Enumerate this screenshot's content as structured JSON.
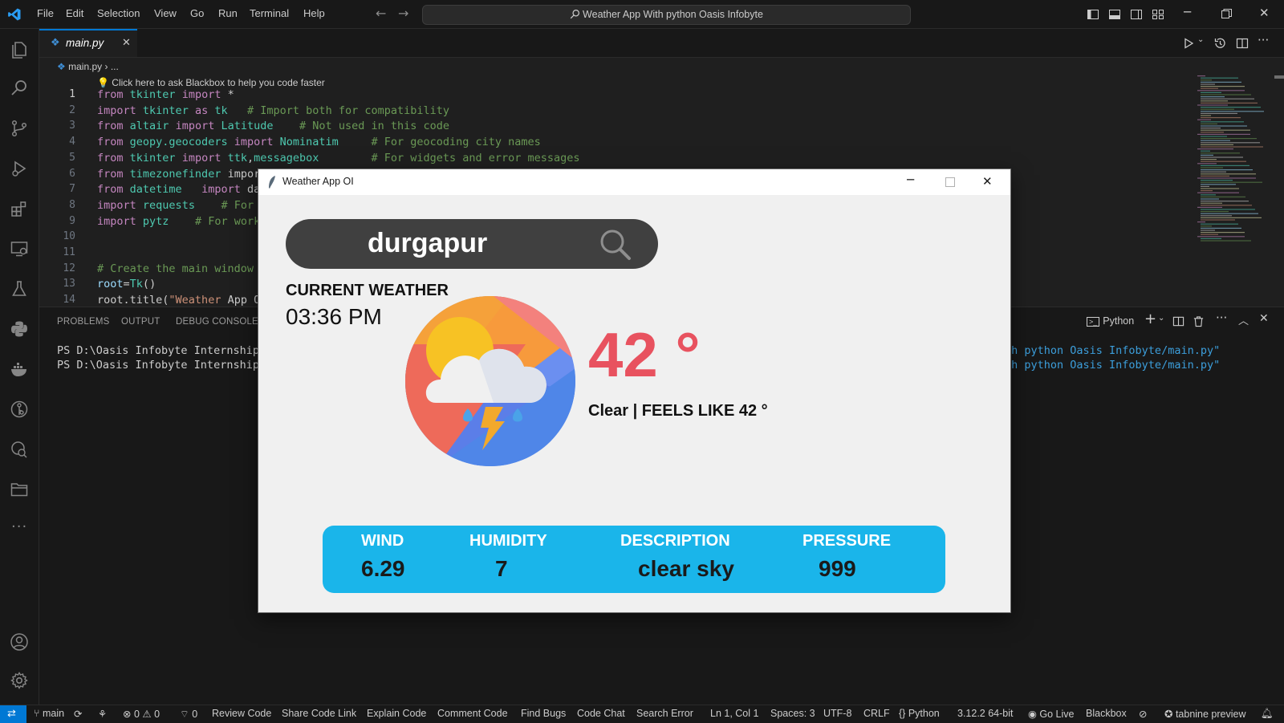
{
  "titlebar": {
    "menu": [
      "File",
      "Edit",
      "Selection",
      "View",
      "Go",
      "Run",
      "Terminal",
      "Help"
    ],
    "search_text": "Weather App With python Oasis Infobyte"
  },
  "tabs": [
    {
      "label": "main.py",
      "close": "✕"
    }
  ],
  "breadcrumb": {
    "file": "main.py",
    "rest": "..."
  },
  "editor": {
    "hint": "Click here to ask Blackbox to help you code faster",
    "line_numbers": [
      "1",
      "2",
      "3",
      "4",
      "5",
      "6",
      "7",
      "8",
      "9",
      "10",
      "11",
      "12",
      "13",
      "14"
    ],
    "lines": [
      "from tkinter import *",
      "import tkinter as tk   # Import both for compatibility",
      "from altair import Latitude    # Not used in this code",
      "from geopy.geocoders import Nominatim     # For geocoding city names",
      "from tkinter import ttk,messagebox        # For widgets and error messages",
      "from timezonefinder impor",
      "from datetime   import da",
      "import requests    # For",
      "import pytz    # For work",
      "",
      "",
      "# Create the main window",
      "root=Tk()",
      "root.title(\"Weather App O"
    ]
  },
  "panel": {
    "tabs": [
      "PROBLEMS",
      "OUTPUT",
      "DEBUG CONSOLE"
    ],
    "terminal_label": "Python",
    "terminal_lines_left": [
      "PS D:\\Oasis Infobyte Internship\\W",
      "PS D:\\Oasis Infobyte Internship\\W"
    ],
    "terminal_lines_right": [
      "th python Oasis Infobyte/main.py\"",
      "th python Oasis Infobyte/main.py\""
    ]
  },
  "status": {
    "branch": "main",
    "errors": "0",
    "warnings": "0",
    "ports": "0",
    "items": [
      "Review Code",
      "Share Code Link",
      "Explain Code",
      "Comment Code",
      "Find Bugs",
      "Code Chat",
      "Search Error"
    ],
    "position": "Ln 1, Col 1",
    "spaces": "Spaces: 3",
    "encoding": "UTF-8",
    "eol": "CRLF",
    "language": "Python",
    "interpreter": "3.12.2 64-bit",
    "golive": "Go Live",
    "blackbox": "Blackbox",
    "tabnine": "tabnine preview"
  },
  "weather_app": {
    "window_title": "Weather App OI",
    "search_value": "durgapur",
    "current_weather_label": "CURRENT WEATHER",
    "time": "03:36 PM",
    "temperature": "42 °",
    "condition": "Clear | FEELS LIKE 42 °",
    "info": {
      "wind_label": "WIND",
      "wind_value": "6.29",
      "humidity_label": "HUMIDITY",
      "humidity_value": "7",
      "description_label": "DESCRIPTION",
      "description_value": "clear sky",
      "pressure_label": "PRESSURE",
      "pressure_value": "999"
    }
  },
  "colors": {
    "accent": "#0078d4",
    "temperature": "#e8525f",
    "info_bar": "#1ab5ea",
    "search_bg": "#404040"
  }
}
